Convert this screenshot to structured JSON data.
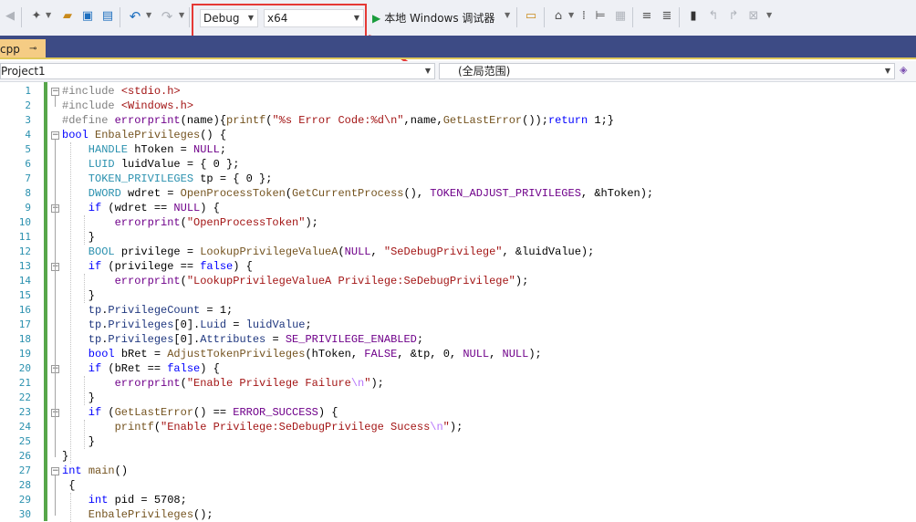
{
  "toolbar": {
    "config_value": "Debug",
    "platform_value": "x64",
    "run_label": "本地 Windows 调试器",
    "accent_red": "#e53935",
    "run_icon_color": "#1a9c3c"
  },
  "document_tab": {
    "name": "cpp",
    "pin": "⊸"
  },
  "navbar": {
    "project": "Project1",
    "scope": "(全局范围)"
  },
  "code": [
    {
      "n": "1",
      "indent": 0,
      "fold": "-",
      "segs": [
        [
          "#include ",
          "dir"
        ],
        [
          "<stdio.h>",
          "str"
        ]
      ]
    },
    {
      "n": "2",
      "indent": 0,
      "segs": [
        [
          "#include ",
          "dir"
        ],
        [
          "<Windows.h>",
          "str"
        ]
      ]
    },
    {
      "n": "3",
      "indent": 0,
      "segs": [
        [
          "#define ",
          "dir"
        ],
        [
          "errorprint",
          "mac"
        ],
        [
          "(name){",
          "p"
        ],
        [
          "printf",
          "fn"
        ],
        [
          "(",
          "p"
        ],
        [
          "\"%s Error Code:%d\\n\"",
          "str"
        ],
        [
          ",name,",
          "p"
        ],
        [
          "GetLastError",
          "fn"
        ],
        [
          "());",
          "p"
        ],
        [
          "return",
          "kw"
        ],
        [
          " 1;}",
          "p"
        ]
      ]
    },
    {
      "n": "4",
      "indent": 0,
      "fold": "-",
      "segs": [
        [
          "bool ",
          "kw"
        ],
        [
          "EnbalePrivileges",
          "fn"
        ],
        [
          "() {",
          "p"
        ]
      ]
    },
    {
      "n": "5",
      "indent": 2,
      "segs": [
        [
          "HANDLE ",
          "typ"
        ],
        [
          "hToken = ",
          "p"
        ],
        [
          "NULL",
          "mac"
        ],
        [
          ";",
          "p"
        ]
      ]
    },
    {
      "n": "6",
      "indent": 2,
      "segs": [
        [
          "LUID ",
          "typ"
        ],
        [
          "luidValue = { 0 };",
          "p"
        ]
      ]
    },
    {
      "n": "7",
      "indent": 2,
      "segs": [
        [
          "TOKEN_PRIVILEGES ",
          "typ"
        ],
        [
          "tp = { 0 };",
          "p"
        ]
      ]
    },
    {
      "n": "8",
      "indent": 2,
      "segs": [
        [
          "DWORD ",
          "typ"
        ],
        [
          "wdret = ",
          "p"
        ],
        [
          "OpenProcessToken",
          "fn"
        ],
        [
          "(",
          "p"
        ],
        [
          "GetCurrentProcess",
          "fn"
        ],
        [
          "(), ",
          "p"
        ],
        [
          "TOKEN_ADJUST_PRIVILEGES",
          "mac"
        ],
        [
          ", &hToken);",
          "p"
        ]
      ]
    },
    {
      "n": "9",
      "indent": 2,
      "fold": "-",
      "segs": [
        [
          "if ",
          "kw"
        ],
        [
          "(wdret == ",
          "p"
        ],
        [
          "NULL",
          "mac"
        ],
        [
          ") {",
          "p"
        ]
      ]
    },
    {
      "n": "10",
      "indent": 4,
      "segs": [
        [
          "errorprint",
          "mac"
        ],
        [
          "(",
          "p"
        ],
        [
          "\"OpenProcessToken\"",
          "str"
        ],
        [
          ");",
          "p"
        ]
      ]
    },
    {
      "n": "11",
      "indent": 2,
      "segs": [
        [
          "}",
          "p"
        ]
      ]
    },
    {
      "n": "12",
      "indent": 2,
      "segs": [
        [
          "BOOL ",
          "typ"
        ],
        [
          "privilege = ",
          "p"
        ],
        [
          "LookupPrivilegeValueA",
          "fn"
        ],
        [
          "(",
          "p"
        ],
        [
          "NULL",
          "mac"
        ],
        [
          ", ",
          "p"
        ],
        [
          "\"SeDebugPrivilege\"",
          "str"
        ],
        [
          ", &luidValue);",
          "p"
        ]
      ]
    },
    {
      "n": "13",
      "indent": 2,
      "fold": "-",
      "segs": [
        [
          "if ",
          "kw"
        ],
        [
          "(privilege == ",
          "p"
        ],
        [
          "false",
          "kw"
        ],
        [
          ") {",
          "p"
        ]
      ]
    },
    {
      "n": "14",
      "indent": 4,
      "segs": [
        [
          "errorprint",
          "mac"
        ],
        [
          "(",
          "p"
        ],
        [
          "\"LookupPrivilegeValueA Privilege:SeDebugPrivilege\"",
          "str"
        ],
        [
          ");",
          "p"
        ]
      ]
    },
    {
      "n": "15",
      "indent": 2,
      "segs": [
        [
          "}",
          "p"
        ]
      ]
    },
    {
      "n": "16",
      "indent": 2,
      "segs": [
        [
          "tp",
          "fld"
        ],
        [
          ".",
          "p"
        ],
        [
          "PrivilegeCount",
          "fld"
        ],
        [
          " = 1;",
          "p"
        ]
      ]
    },
    {
      "n": "17",
      "indent": 2,
      "segs": [
        [
          "tp",
          "fld"
        ],
        [
          ".",
          "p"
        ],
        [
          "Privileges",
          "fld"
        ],
        [
          "[0].",
          "p"
        ],
        [
          "Luid",
          "fld"
        ],
        [
          " = ",
          "p"
        ],
        [
          "luidValue",
          "fld"
        ],
        [
          ";",
          "p"
        ]
      ]
    },
    {
      "n": "18",
      "indent": 2,
      "segs": [
        [
          "tp",
          "fld"
        ],
        [
          ".",
          "p"
        ],
        [
          "Privileges",
          "fld"
        ],
        [
          "[0].",
          "p"
        ],
        [
          "Attributes",
          "fld"
        ],
        [
          " = ",
          "p"
        ],
        [
          "SE_PRIVILEGE_ENABLED",
          "mac"
        ],
        [
          ";",
          "p"
        ]
      ]
    },
    {
      "n": "19",
      "indent": 2,
      "segs": [
        [
          "bool ",
          "kw"
        ],
        [
          "bRet = ",
          "p"
        ],
        [
          "AdjustTokenPrivileges",
          "fn"
        ],
        [
          "(hToken, ",
          "p"
        ],
        [
          "FALSE",
          "mac"
        ],
        [
          ", &tp, 0, ",
          "p"
        ],
        [
          "NULL",
          "mac"
        ],
        [
          ", ",
          "p"
        ],
        [
          "NULL",
          "mac"
        ],
        [
          ");",
          "p"
        ]
      ]
    },
    {
      "n": "20",
      "indent": 2,
      "fold": "-",
      "segs": [
        [
          "if ",
          "kw"
        ],
        [
          "(bRet == ",
          "p"
        ],
        [
          "false",
          "kw"
        ],
        [
          ") {",
          "p"
        ]
      ]
    },
    {
      "n": "21",
      "indent": 4,
      "segs": [
        [
          "errorprint",
          "mac"
        ],
        [
          "(",
          "p"
        ],
        [
          "\"Enable Privilege Failure",
          "str"
        ],
        [
          "\\n",
          "esc"
        ],
        [
          "\"",
          "str"
        ],
        [
          ");",
          "p"
        ]
      ]
    },
    {
      "n": "22",
      "indent": 2,
      "segs": [
        [
          "}",
          "p"
        ]
      ]
    },
    {
      "n": "23",
      "indent": 2,
      "fold": "-",
      "segs": [
        [
          "if ",
          "kw"
        ],
        [
          "(",
          "p"
        ],
        [
          "GetLastError",
          "fn"
        ],
        [
          "() == ",
          "p"
        ],
        [
          "ERROR_SUCCESS",
          "mac"
        ],
        [
          ") {",
          "p"
        ]
      ]
    },
    {
      "n": "24",
      "indent": 4,
      "segs": [
        [
          "printf",
          "fn"
        ],
        [
          "(",
          "p"
        ],
        [
          "\"Enable Privilege:SeDebugPrivilege Sucess",
          "str"
        ],
        [
          "\\n",
          "esc"
        ],
        [
          "\"",
          "str"
        ],
        [
          ");",
          "p"
        ]
      ]
    },
    {
      "n": "25",
      "indent": 2,
      "segs": [
        [
          "}",
          "p"
        ]
      ]
    },
    {
      "n": "26",
      "indent": 0,
      "segs": [
        [
          "}",
          "p"
        ]
      ]
    },
    {
      "n": "27",
      "indent": 0,
      "fold": "-",
      "segs": [
        [
          "int ",
          "kw"
        ],
        [
          "main",
          "fn"
        ],
        [
          "()",
          "p"
        ]
      ]
    },
    {
      "n": "28",
      "indent": 0,
      "segs": [
        [
          " {",
          "p"
        ]
      ]
    },
    {
      "n": "29",
      "indent": 2,
      "segs": [
        [
          "int ",
          "kw"
        ],
        [
          "pid = 5708;",
          "p"
        ]
      ]
    },
    {
      "n": "30",
      "indent": 2,
      "segs": [
        [
          "EnbalePrivileges",
          "fn"
        ],
        [
          "();",
          "p"
        ]
      ]
    }
  ],
  "colors": {
    "dir": "#808080",
    "str": "#a31515",
    "kw": "#0000ff",
    "typ": "#2b91af",
    "mac": "#6f008a",
    "fn": "#74531f",
    "fld": "#1f377f",
    "esc": "#b776fb",
    "p": "#000000"
  }
}
